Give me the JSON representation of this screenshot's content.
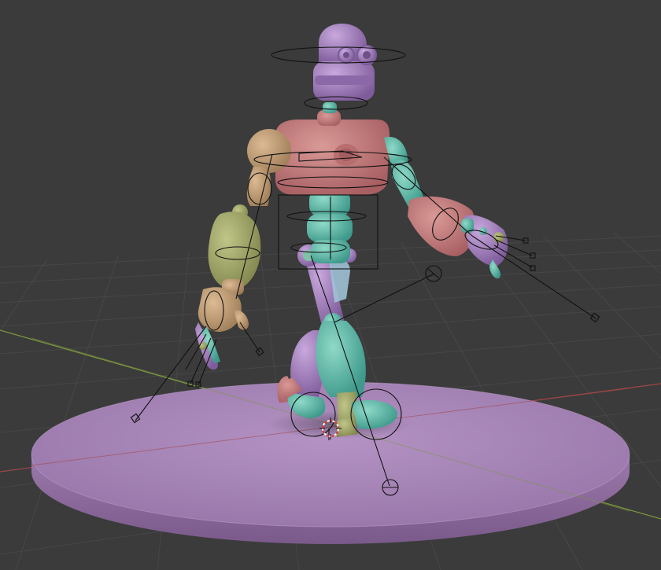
{
  "viewport": {
    "background": "#3b3b3b",
    "grid_color": "#474747",
    "x_axis_color": "#a04646",
    "y_axis_color": "#7d9640"
  },
  "colors": {
    "pink": "#c97b7b",
    "teal": "#6cc2b0",
    "purple": "#a985c6",
    "olive": "#a4aa64",
    "tan": "#c6a279",
    "platform": "#a985bb",
    "rig_lines": "#111111",
    "cursor_red": "#d43c3c"
  },
  "objects": {
    "platform": "platform",
    "robot": "robot-character",
    "armature": "armature-rig",
    "cursor": "3d-cursor"
  }
}
